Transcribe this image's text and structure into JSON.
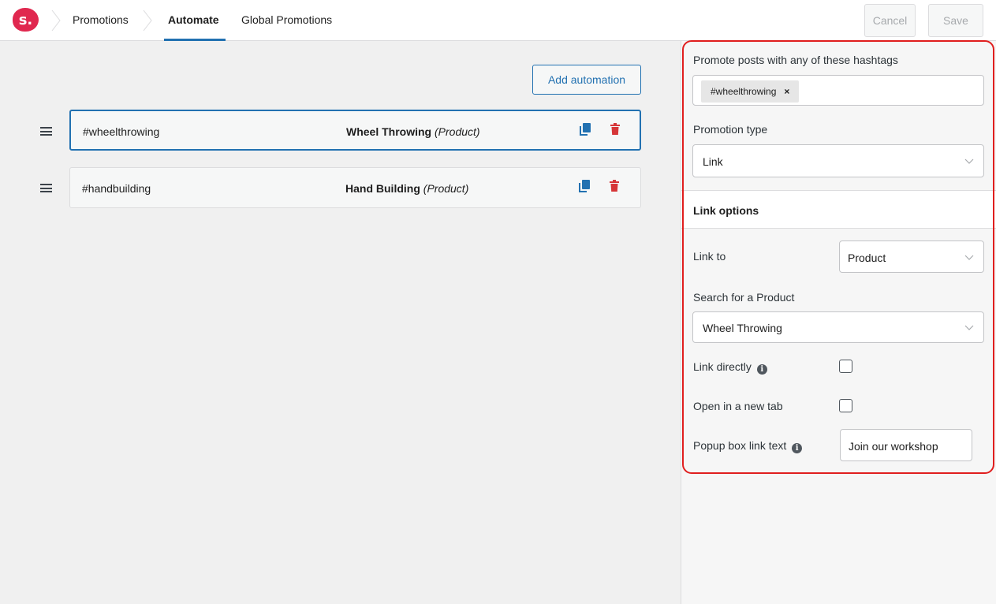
{
  "nav": {
    "logo": "s.",
    "promotions": "Promotions",
    "automate": "Automate",
    "global_promotions": "Global Promotions",
    "cancel": "Cancel",
    "save": "Save"
  },
  "main": {
    "add_automation": "Add automation",
    "rows": [
      {
        "hashtag": "#wheelthrowing",
        "product": "Wheel Throwing",
        "type": "(Product)",
        "selected": true
      },
      {
        "hashtag": "#handbuilding",
        "product": "Hand Building",
        "type": "(Product)",
        "selected": false
      }
    ]
  },
  "panel": {
    "hashtags_label": "Promote posts with any of these hashtags",
    "hashtag_chip": "#wheelthrowing",
    "chip_remove": "×",
    "promotion_type_label": "Promotion type",
    "promotion_type_value": "Link",
    "link_options_heading": "Link options",
    "link_to_label": "Link to",
    "link_to_value": "Product",
    "search_product_label": "Search for a Product",
    "search_product_value": "Wheel Throwing",
    "link_directly_label": "Link directly",
    "open_new_tab_label": "Open in a new tab",
    "popup_link_text_label": "Popup box link text",
    "popup_link_text_value": "Join our workshop",
    "info_glyph": "i"
  },
  "colors": {
    "accent": "#2271b1",
    "brand": "#e0284f",
    "delete": "#d63638",
    "highlight": "#e01e1e"
  },
  "icons": [
    "drag-handle-icon",
    "duplicate-icon",
    "trash-icon",
    "chevron-down-icon",
    "info-icon",
    "close-icon",
    "breadcrumb-chevron-icon"
  ]
}
